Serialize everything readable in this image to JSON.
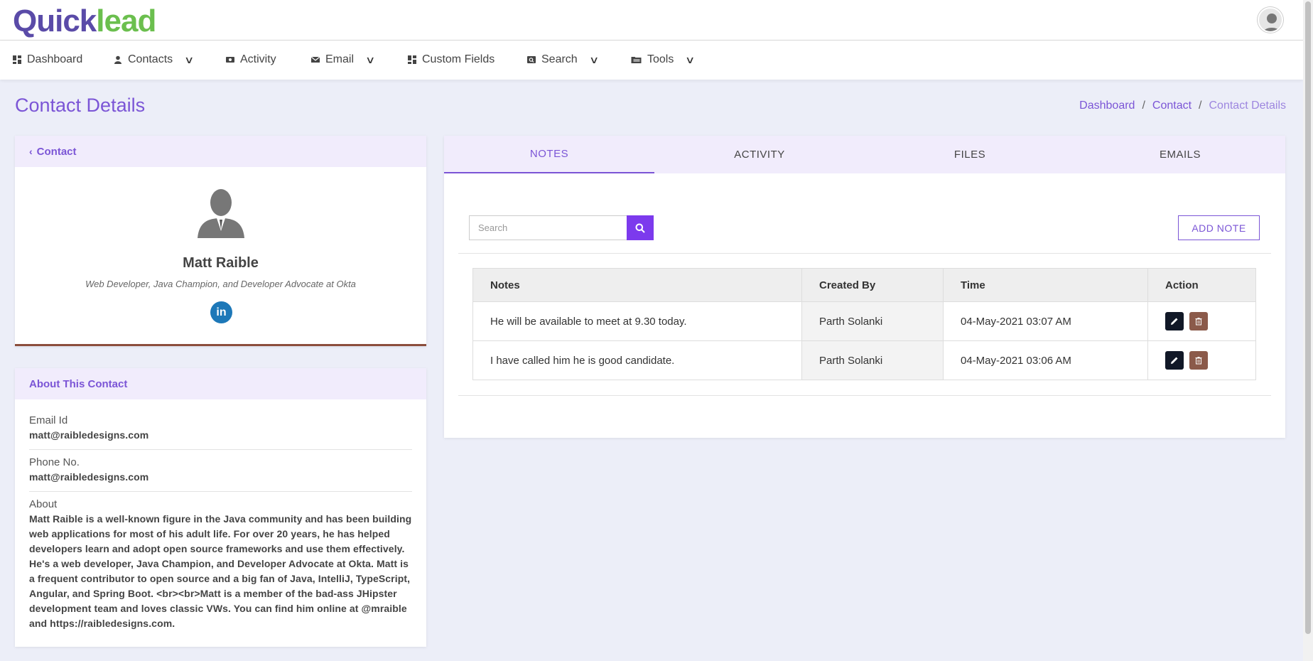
{
  "brand": {
    "logo_part1": "Quick",
    "logo_part2": "lead"
  },
  "nav": {
    "items": [
      {
        "label": "Dashboard",
        "icon": "dashboard-icon",
        "dropdown": false
      },
      {
        "label": "Contacts",
        "icon": "person-icon",
        "dropdown": true
      },
      {
        "label": "Activity",
        "icon": "activity-icon",
        "dropdown": false
      },
      {
        "label": "Email",
        "icon": "mail-icon",
        "dropdown": true
      },
      {
        "label": "Custom Fields",
        "icon": "grid-icon",
        "dropdown": false
      },
      {
        "label": "Search",
        "icon": "search-box-icon",
        "dropdown": true
      },
      {
        "label": "Tools",
        "icon": "folder-icon",
        "dropdown": true
      }
    ]
  },
  "page": {
    "title": "Contact Details",
    "breadcrumb": [
      "Dashboard",
      "Contact",
      "Contact Details"
    ]
  },
  "profile": {
    "back_label": "Contact",
    "name": "Matt Raible",
    "title": "Web Developer, Java Champion, and Developer Advocate at Okta",
    "linkedin": "in"
  },
  "about": {
    "header": "About This Contact",
    "fields": [
      {
        "label": "Email Id",
        "value": "matt@raibledesigns.com"
      },
      {
        "label": "Phone No.",
        "value": "matt@raibledesigns.com"
      },
      {
        "label": "About",
        "value": "Matt Raible is a well-known figure in the Java community and has been building web applications for most of his adult life. For over 20 years, he has helped developers learn and adopt open source frameworks and use them effectively. He's a web developer, Java Champion, and Developer Advocate at Okta. Matt is a frequent contributor to open source and a big fan of Java, IntelliJ, TypeScript, Angular, and Spring Boot. <br><br>Matt is a member of the bad-ass JHipster development team and loves classic VWs. You can find him online at @mraible and https://raibledesigns.com."
      }
    ]
  },
  "tabs": [
    "NOTES",
    "ACTIVITY",
    "FILES",
    "EMAILS"
  ],
  "notes": {
    "search_placeholder": "Search",
    "add_label": "ADD NOTE",
    "columns": [
      "Notes",
      "Created By",
      "Time",
      "Action"
    ],
    "rows": [
      {
        "note": "He will be available to meet at 9.30 today.",
        "created_by": "Parth  Solanki",
        "time": "04-May-2021 03:07 AM"
      },
      {
        "note": "I have called him he is good candidate.",
        "created_by": "Parth  Solanki",
        "time": "04-May-2021 03:06 AM"
      }
    ]
  },
  "colors": {
    "accent": "#7b55d6",
    "tab_bg": "#f1ecfc",
    "edit_btn": "#111827",
    "delete_btn": "#8b5a4a",
    "linkedin": "#1d78b8"
  }
}
